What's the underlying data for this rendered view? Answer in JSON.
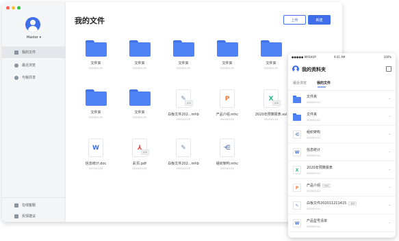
{
  "desktop": {
    "username": "Master ▾",
    "title": "我的文件",
    "upload_label": "上传",
    "new_label": "新建",
    "nav": [
      {
        "label": "我的文件",
        "icon": "folder-icon"
      },
      {
        "label": "最近浏览",
        "icon": "clock-icon"
      },
      {
        "label": "与我共享",
        "icon": "user-icon"
      }
    ],
    "bottom_nav": [
      {
        "label": "在线客服",
        "icon": "chat-icon"
      },
      {
        "label": "反馈建议",
        "icon": "feedback-icon"
      }
    ],
    "files": [
      {
        "name": "文件夹",
        "date": "2020/01/20",
        "type": "folder"
      },
      {
        "name": "文件夹",
        "date": "2020/01/20",
        "type": "folder"
      },
      {
        "name": "文件夹",
        "date": "2020/01/20",
        "type": "folder"
      },
      {
        "name": "文件夹",
        "date": "2020/01/20",
        "type": "folder"
      },
      {
        "name": "文件夹",
        "date": "2020/01/20",
        "type": "folder"
      },
      {
        "name": "文件夹",
        "date": "2020/01/20",
        "type": "folder"
      },
      {
        "name": "文件夹",
        "date": "2020/01/20",
        "type": "folder"
      },
      {
        "name": "白板文件202...mhb",
        "date": "2020/01/20",
        "type": "whiteboard",
        "glyph": "✎",
        "badge": "共享"
      },
      {
        "name": "产品介绍.mhc",
        "date": "2020/01/20",
        "type": "presentation",
        "glyph": "P"
      },
      {
        "name": "2020年预算报表.xsl",
        "date": "2020/01/20",
        "type": "sheet",
        "glyph": "X",
        "badge": "共享"
      },
      {
        "name": "信息统计.doc",
        "date": "2020/01/20",
        "type": "word",
        "glyph": "W"
      },
      {
        "name": "彩页.pdf",
        "date": "2020/01/20",
        "type": "pdf",
        "glyph": "⅄",
        "badge": "共享"
      },
      {
        "name": "白板文件202...mhb",
        "date": "2020/01/20",
        "type": "whiteboard",
        "glyph": "✎"
      },
      {
        "name": "组织架构.mhc",
        "date": "2020/01/20",
        "type": "mindmap",
        "glyph": "⋲"
      }
    ]
  },
  "mobile": {
    "status_left": "●●●●● MASHUP",
    "status_time": "9:41 AM",
    "status_right": "100%",
    "title": "我的资料夹",
    "tabs": [
      "最近浏览",
      "我的文件"
    ],
    "active_tab": 1,
    "rows": [
      {
        "name": "文件夹",
        "date": "2020/01/12",
        "type": "folder"
      },
      {
        "name": "文件夹",
        "date": "2020/01/12",
        "type": "folder"
      },
      {
        "name": "组织架构",
        "date": "2020/01/12",
        "type": "mindmap",
        "glyph": "⋲"
      },
      {
        "name": "信息统计",
        "date": "2020/01/12",
        "type": "word",
        "glyph": "W"
      },
      {
        "name": "2020年预算报表",
        "date": "2020/01/12",
        "type": "sheet",
        "glyph": "X"
      },
      {
        "name": "产品介绍",
        "date": "2020/01/12",
        "type": "presentation",
        "glyph": "P",
        "badge": "共享"
      },
      {
        "name": "白板文件202011211415",
        "date": "2020/01/12",
        "type": "whiteboard",
        "glyph": "✎",
        "badge": "共享"
      },
      {
        "name": "产品型号清单",
        "date": "2020/01/12",
        "type": "word",
        "glyph": "W"
      }
    ],
    "more_label": "···"
  },
  "colors": {
    "accent": "#3f6ee8",
    "folder": "#4f82f5",
    "word": "#3d6fe0",
    "sheet": "#2db48a",
    "presentation": "#f07a3a",
    "pdf": "#e84a3a",
    "whiteboard": "#7385a4",
    "mindmap": "#5f7fbe",
    "traffic_red": "#ff5f57",
    "traffic_yellow": "#febc2e",
    "traffic_green": "#28c840"
  }
}
